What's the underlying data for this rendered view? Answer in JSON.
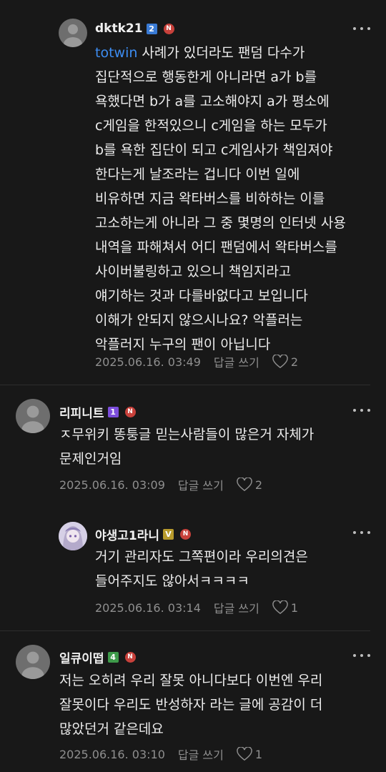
{
  "comments": [
    {
      "username": "dktk21",
      "level": "2",
      "level_color": "#3a7bd5",
      "badge": "N",
      "mention": "totwin",
      "text": " 사례가 있더라도 팬덤 다수가\n집단적으로 행동한게 아니라면 a가 b를\n욕했다면 b가 a를 고소해야지 a가 평소에\nc게임을 한적있으니 c게임을 하는 모두가\nb를 욕한 집단이 되고 c게임사가 책임져야\n한다는게 날조라는 겁니다 이번 일에\n비유하면 지금 왁타버스를 비하하는 이를\n고소하는게 아니라 그 중 몇명의 인터넷 사용\n내역을 파해쳐서 어디 팬덤에서 왁타버스를\n사이버불링하고 있으니 책임지라고\n얘기하는 것과 다를바없다고 보입니다\n이해가 안되지 않으시나요? 악플러는\n악플러지 누구의 팬이 아닙니다",
      "date": "2025.06.16. 03:49",
      "reply": "답글 쓰기",
      "likes": "2"
    },
    {
      "username": "리피니트",
      "level": "1",
      "level_color": "#7c4ddc",
      "badge": "N",
      "text": "ㅈ무위키 똥퉁글 믿는사람들이 많은거 자체가\n문제인거임",
      "date": "2025.06.16. 03:09",
      "reply": "답글 쓰기",
      "likes": "2"
    },
    {
      "username": "야생고1라니",
      "level": "V",
      "level_color": "#b89b2c",
      "badge": "N",
      "text": "거기 관리자도 그쪽편이라 우리의견은\n들어주지도 않아서ㅋㅋㅋㅋ",
      "date": "2025.06.16. 03:14",
      "reply": "답글 쓰기",
      "likes": "1"
    },
    {
      "username": "일큐이떱",
      "level": "4",
      "level_color": "#3e9a4a",
      "badge": "N",
      "text": "저는 오히려 우리 잘못 아니다보다 이번엔 우리\n잘못이다 우리도 반성하자 라는 글에 공감이 더\n많았던거 같은데요",
      "date": "2025.06.16. 03:10",
      "reply": "답글 쓰기",
      "likes": "1"
    }
  ]
}
